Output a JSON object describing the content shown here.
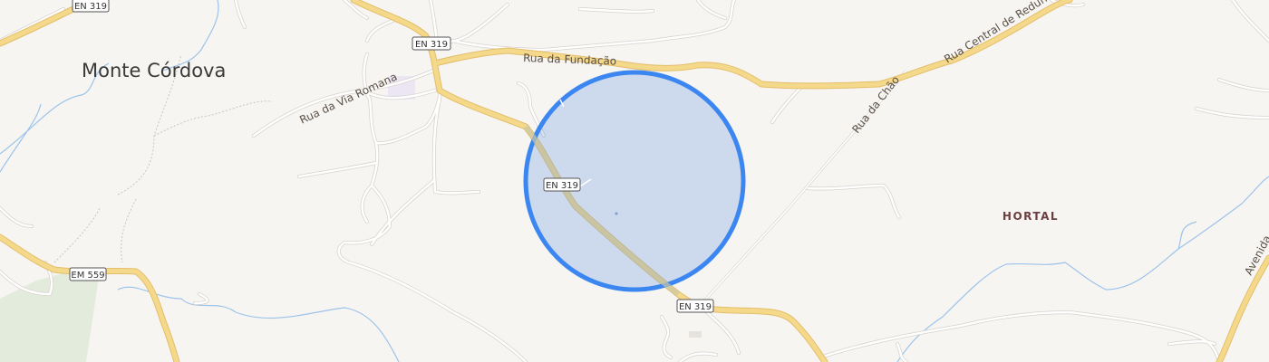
{
  "map": {
    "place_labels": {
      "monte_cordova": "Monte Córdova",
      "hortal": "HORTAL"
    },
    "road_shields": {
      "en319_top": "EN 319",
      "en319_upper": "EN 319",
      "en319_mid": "EN 319",
      "en319_lower": "EN 319",
      "em559": "EM 559"
    },
    "street_labels": {
      "rua_fundacao": "Rua da Fundação",
      "rua_via_romana": "Rua da Via Romana",
      "rua_central": "Rua Central de Redundo",
      "rua_chao": "Rua da Chão",
      "avenida": "Avenida"
    },
    "colors": {
      "background": "#f7f5f2",
      "main_road": "#f5d98a",
      "main_road_casing": "#e3bd6b",
      "minor_road": "#ffffff",
      "minor_road_casing": "#d6d2cc",
      "water": "#9cc3ea",
      "park": "#e3ebdd",
      "accuracy_fill": "#cadcf4",
      "accuracy_stroke": "#3b86f0",
      "label_text": "#555555",
      "place_text": "#6b3f3f"
    }
  }
}
